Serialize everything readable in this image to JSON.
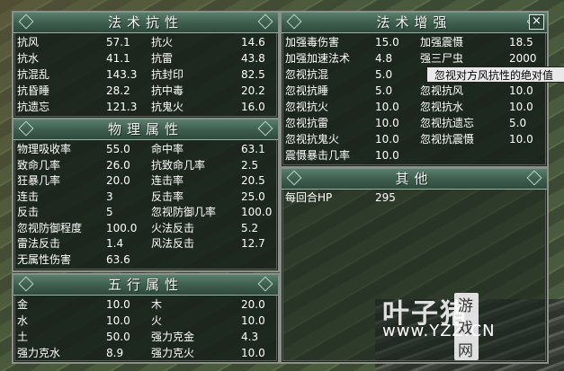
{
  "fashu_kangxing": {
    "title": "法术抗性",
    "rows": [
      [
        "抗风",
        "57.1",
        "抗火",
        "14.6"
      ],
      [
        "抗水",
        "41.1",
        "抗雷",
        "43.8"
      ],
      [
        "抗混乱",
        "143.3",
        "抗封印",
        "82.5"
      ],
      [
        "抗昏睡",
        "28.2",
        "抗中毒",
        "20.2"
      ],
      [
        "抗遗忘",
        "121.3",
        "抗鬼火",
        "16.0"
      ]
    ]
  },
  "wuli_shuxing": {
    "title": "物理属性",
    "rows": [
      [
        "物理吸收率",
        "55.0",
        "命中率",
        "63.1"
      ],
      [
        "致命几率",
        "26.0",
        "抗致命几率",
        "2.5"
      ],
      [
        "狂暴几率",
        "20.0",
        "连击率",
        "20.5"
      ],
      [
        "连击",
        "3",
        "反击率",
        "25.0"
      ],
      [
        "反击",
        "5",
        "忽视防御几率",
        "100.0"
      ],
      [
        "忽视防御程度",
        "100.0",
        "火法反击",
        "5.2"
      ],
      [
        "雷法反击",
        "1.4",
        "风法反击",
        "12.7"
      ],
      [
        "无属性伤害",
        "63.6",
        "",
        ""
      ]
    ]
  },
  "wuxing_shuxing": {
    "title": "五行属性",
    "rows": [
      [
        "金",
        "10.0",
        "木",
        "20.0"
      ],
      [
        "水",
        "10.0",
        "火",
        "10.0"
      ],
      [
        "土",
        "50.0",
        "强力克金",
        "4.3"
      ],
      [
        "强力克水",
        "8.9",
        "强力克火",
        "10.0"
      ]
    ]
  },
  "fashu_zengqiang": {
    "title": "法术增强",
    "close_label": "×",
    "rows": [
      [
        "加强毒伤害",
        "15.0",
        "加强震慑",
        "18.5"
      ],
      [
        "加强加速法术",
        "4.8",
        "强三尸虫",
        "2000"
      ],
      [
        "忽视抗混",
        "5.0",
        "",
        ""
      ],
      [
        "忽视抗睡",
        "5.0",
        "忽视抗风",
        "10.0"
      ],
      [
        "忽视抗火",
        "10.0",
        "忽视抗水",
        "10.0"
      ],
      [
        "忽视抗雷",
        "10.0",
        "忽视抗遗忘",
        "5.0"
      ],
      [
        "忽视抗鬼火",
        "10.0",
        "忽视抗震慑",
        "10.0"
      ],
      [
        "震慑暴击几率",
        "10.0",
        "",
        ""
      ]
    ],
    "tooltip": "忽视对方风抗性的绝对值"
  },
  "qita": {
    "title": "其他",
    "rows": [
      [
        "每回合HP",
        "295",
        "",
        ""
      ]
    ]
  },
  "watermark": {
    "brand": "叶子猪",
    "tag": "游戏网",
    "url": "www.YZZ.CN"
  }
}
